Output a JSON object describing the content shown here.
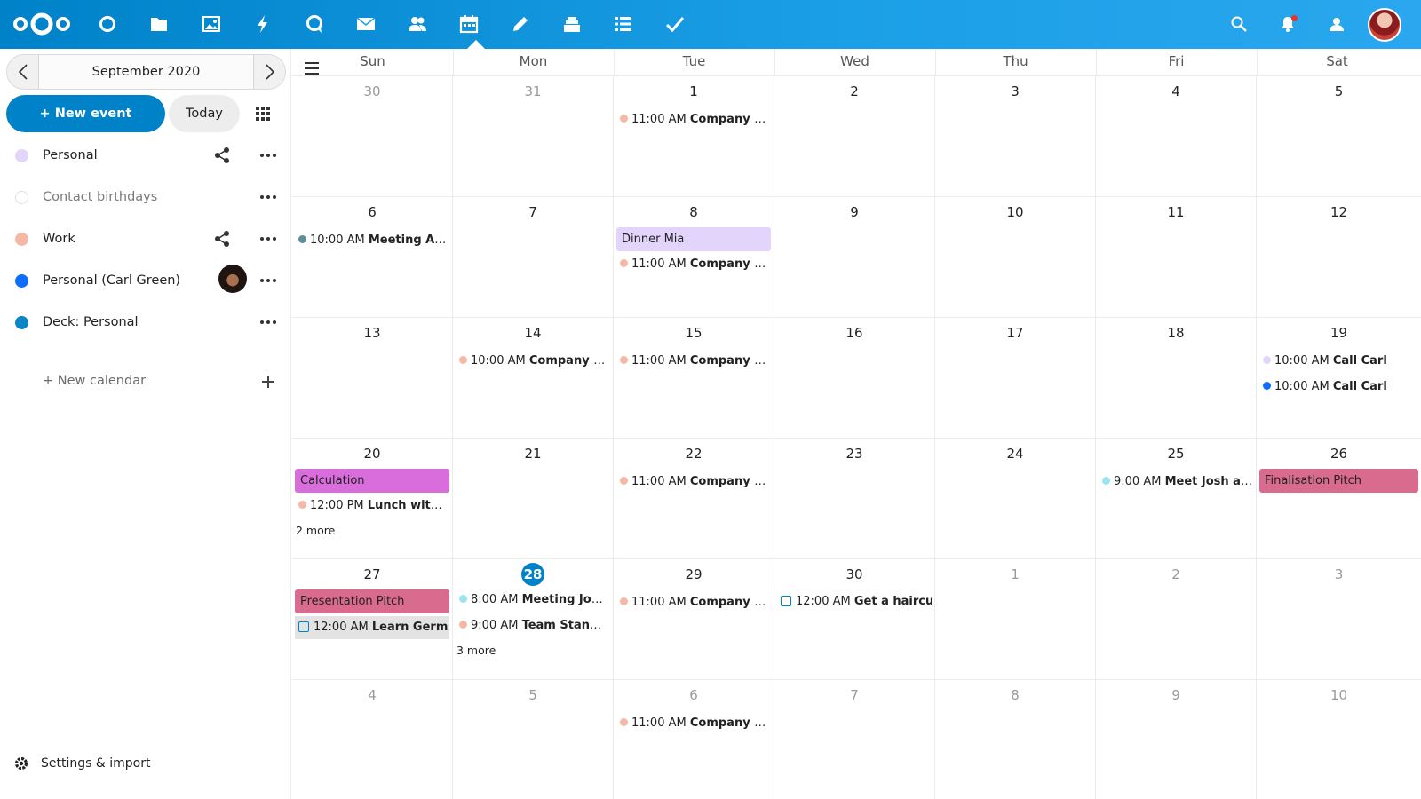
{
  "colors": {
    "accent": "#0082c9",
    "personal": "#e3d4fb",
    "work": "#f5b8a6",
    "carl_green": "#0d6efd",
    "deck": "#0c84c6",
    "calculation": "#d96ddb",
    "pitch": "#d96b8e",
    "meet_josh": "#9be4ef",
    "meeting_anna": "#5c8f9b",
    "task_bg": "#e3e3e3"
  },
  "topbar": {
    "apps": [
      {
        "name": "dashboard-app-icon",
        "icon": "circle"
      },
      {
        "name": "files-app-icon",
        "icon": "folder"
      },
      {
        "name": "photos-app-icon",
        "icon": "image"
      },
      {
        "name": "activity-app-icon",
        "icon": "bolt"
      },
      {
        "name": "talk-app-icon",
        "icon": "speech"
      },
      {
        "name": "mail-app-icon",
        "icon": "envelope"
      },
      {
        "name": "contacts-app-icon",
        "icon": "people"
      },
      {
        "name": "calendar-app-icon",
        "icon": "calendar"
      },
      {
        "name": "notes-app-icon",
        "icon": "pencil"
      },
      {
        "name": "deck-app-icon",
        "icon": "stack"
      },
      {
        "name": "tasks-app-icon",
        "icon": "list"
      },
      {
        "name": "checkmark-app-icon",
        "icon": "check"
      }
    ]
  },
  "sidebar": {
    "month_label": "September 2020",
    "new_event": "+ New event",
    "today": "Today",
    "calendars": [
      {
        "label": "Personal",
        "color": "#e3d4fb",
        "shared": true
      },
      {
        "label": "Contact birthdays",
        "color": "#ffffff",
        "shared": false
      },
      {
        "label": "Work",
        "color": "#f5b8a6",
        "shared": true
      },
      {
        "label": "Personal (Carl Green)",
        "color": "#0d6efd",
        "shared": false
      },
      {
        "label": "Deck: Personal",
        "color": "#0c84c6",
        "shared": false
      }
    ],
    "new_calendar": "+ New calendar",
    "settings": "Settings & import"
  },
  "calendar": {
    "day_headers": [
      "Sun",
      "Mon",
      "Tue",
      "Wed",
      "Thu",
      "Fri",
      "Sat"
    ],
    "weeks": [
      {
        "days": [
          "30",
          "31",
          "1",
          "2",
          "3",
          "4",
          "5"
        ]
      },
      {
        "days": [
          "6",
          "7",
          "8",
          "9",
          "10",
          "11",
          "12"
        ]
      },
      {
        "days": [
          "13",
          "14",
          "15",
          "16",
          "17",
          "18",
          "19"
        ]
      },
      {
        "days": [
          "20",
          "21",
          "22",
          "23",
          "24",
          "25",
          "26"
        ]
      },
      {
        "days": [
          "27",
          "28",
          "29",
          "30",
          "1",
          "2",
          "3"
        ]
      },
      {
        "days": [
          "4",
          "5",
          "6",
          "7",
          "8",
          "9",
          "10"
        ]
      }
    ],
    "events": {
      "w0_tue": {
        "time": "11:00 AM",
        "title": "Company call"
      },
      "w1_sun": {
        "time": "10:00 AM",
        "title": "Meeting Anna"
      },
      "w1_tue_bar": "Dinner Mia",
      "w1_tue": {
        "time": "11:00 AM",
        "title": "Company call"
      },
      "w2_mon": {
        "time": "10:00 AM",
        "title": "Company Sta..."
      },
      "w2_tue": {
        "time": "11:00 AM",
        "title": "Company call"
      },
      "w2_sat_1": {
        "time": "10:00 AM",
        "title": "Call Carl"
      },
      "w2_sat_2": {
        "time": "10:00 AM",
        "title": "Call Carl"
      },
      "w3_sun_bar": "Calculation",
      "w3_sun": {
        "time": "12:00 PM",
        "title": "Lunch with m..."
      },
      "w3_sun_more": "2 more",
      "w3_tue": {
        "time": "11:00 AM",
        "title": "Company call"
      },
      "w3_fri": {
        "time": "9:00 AM",
        "title": "Meet Josh at ..."
      },
      "w3_sat_bar": "Finalisation Pitch",
      "w4_sun_bar": "Presentation Pitch",
      "w4_sun_task": {
        "time": "12:00 AM",
        "title": "Learn German"
      },
      "w4_mon_1": {
        "time": "8:00 AM",
        "title": "Meeting Josh ..."
      },
      "w4_mon_2": {
        "time": "9:00 AM",
        "title": "Team Stand UP"
      },
      "w4_mon_more": "3 more",
      "w4_tue": {
        "time": "11:00 AM",
        "title": "Company call"
      },
      "w4_wed_task": {
        "time": "12:00 AM",
        "title": "Get a haircut"
      },
      "w5_tue": {
        "time": "11:00 AM",
        "title": "Company call"
      }
    }
  }
}
